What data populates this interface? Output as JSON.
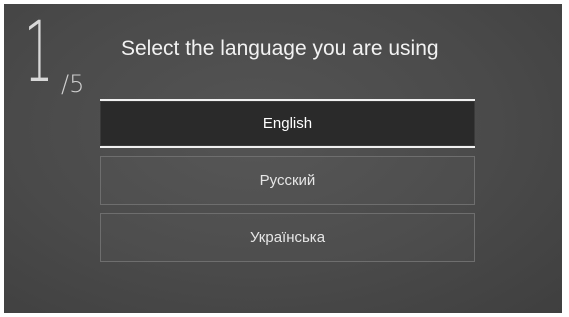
{
  "wizard": {
    "step_current": "1",
    "step_total": "/5",
    "title": "Select the language you are using"
  },
  "languages": [
    {
      "label": "English",
      "selected": true
    },
    {
      "label": "Русский",
      "selected": false
    },
    {
      "label": "Українська",
      "selected": false
    }
  ]
}
